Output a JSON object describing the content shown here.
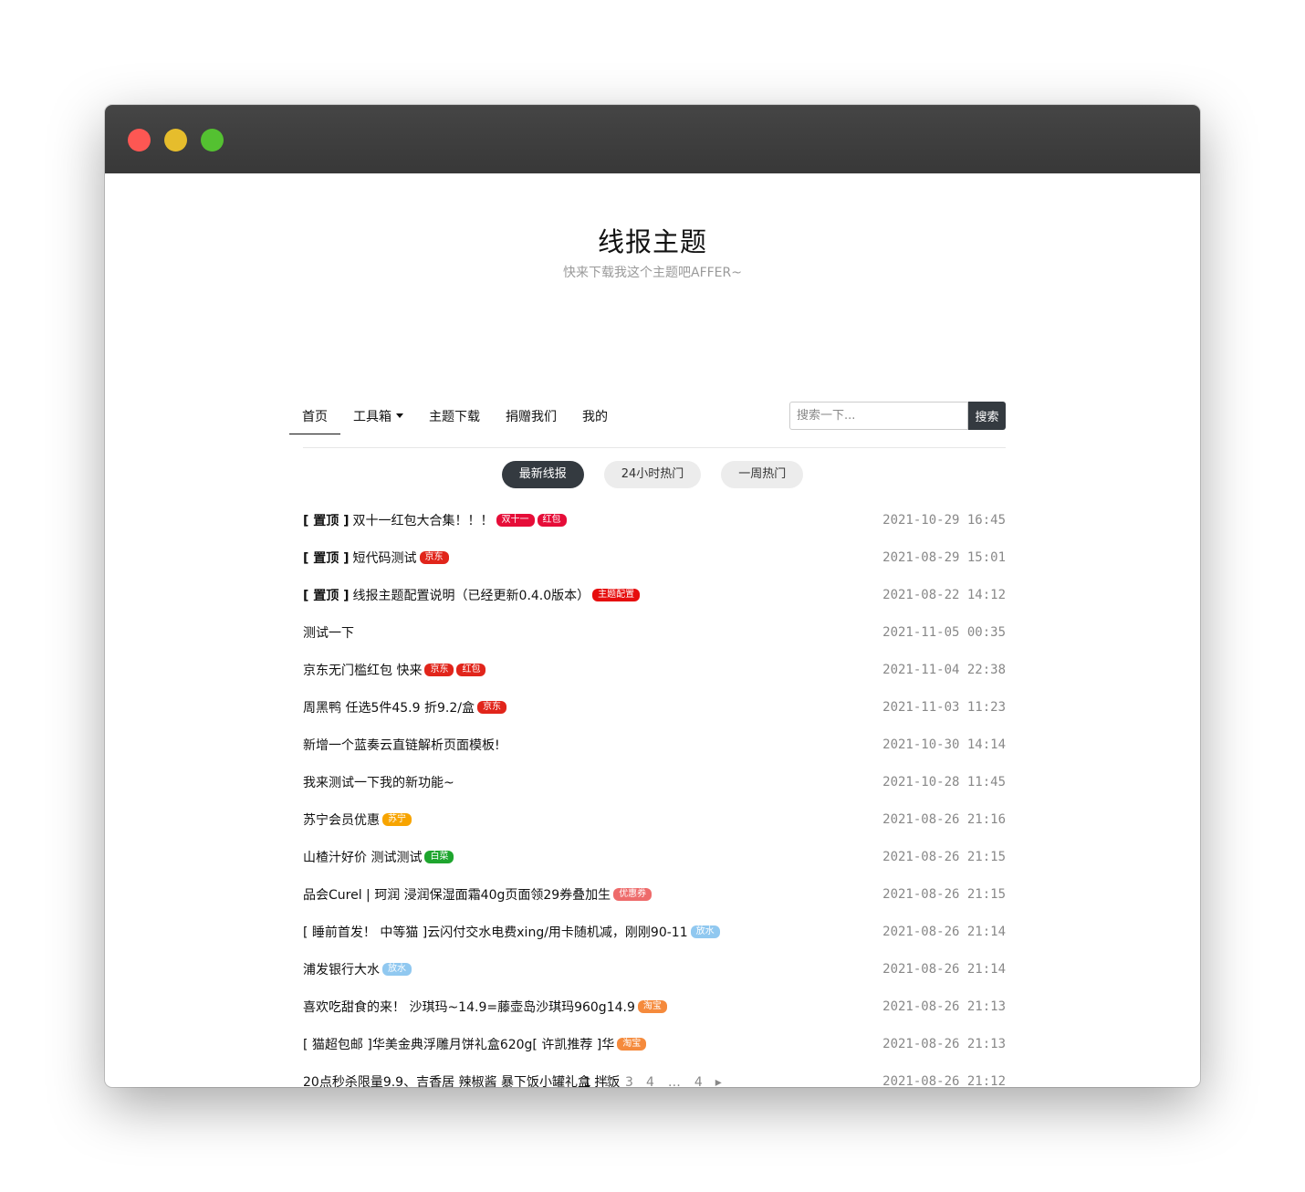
{
  "site": {
    "title": "线报主题",
    "subtitle": "快来下载我这个主题吧AFFER~"
  },
  "nav": {
    "items": [
      "首页",
      "工具箱",
      "主题下载",
      "捐赠我们",
      "我的"
    ]
  },
  "search": {
    "placeholder": "搜索一下...",
    "button": "搜索"
  },
  "tabs": [
    "最新线报",
    "24小时热门",
    "一周热门"
  ],
  "posts": [
    {
      "pinned": true,
      "pin_label": "[ 置顶 ]",
      "title": "双十一红包大合集！！！",
      "tags": [
        {
          "text": "双十一",
          "color": "#e60d38"
        },
        {
          "text": "红包",
          "color": "#e60d38"
        }
      ],
      "date": "2021-10-29 16:45"
    },
    {
      "pinned": true,
      "pin_label": "[ 置顶 ]",
      "title": "短代码测试",
      "tags": [
        {
          "text": "京东",
          "color": "#e1251b"
        }
      ],
      "date": "2021-08-29 15:01"
    },
    {
      "pinned": true,
      "pin_label": "[ 置顶 ]",
      "title": "线报主题配置说明（已经更新0.4.0版本）",
      "tags": [
        {
          "text": "主题配置",
          "color": "#e60d0d"
        }
      ],
      "date": "2021-08-22 14:12"
    },
    {
      "pinned": false,
      "pin_label": "",
      "title": "测试一下",
      "tags": [],
      "date": "2021-11-05 00:35"
    },
    {
      "pinned": false,
      "pin_label": "",
      "title": "京东无门槛红包 快来",
      "tags": [
        {
          "text": "京东",
          "color": "#e1251b"
        },
        {
          "text": "红包",
          "color": "#e1251b"
        }
      ],
      "date": "2021-11-04 22:38"
    },
    {
      "pinned": false,
      "pin_label": "",
      "title": "周黑鸭 任选5件45.9  折9.2/盒",
      "tags": [
        {
          "text": "京东",
          "color": "#e1251b"
        }
      ],
      "date": "2021-11-03 11:23"
    },
    {
      "pinned": false,
      "pin_label": "",
      "title": "新增一个蓝奏云直链解析页面模板!",
      "tags": [],
      "date": "2021-10-30 14:14"
    },
    {
      "pinned": false,
      "pin_label": "",
      "title": "我来测试一下我的新功能~",
      "tags": [],
      "date": "2021-10-28 11:45"
    },
    {
      "pinned": false,
      "pin_label": "",
      "title": "苏宁会员优惠",
      "tags": [
        {
          "text": "苏宁",
          "color": "#f7a400"
        }
      ],
      "date": "2021-08-26 21:16"
    },
    {
      "pinned": false,
      "pin_label": "",
      "title": "山楂汁好价 测试测试",
      "tags": [
        {
          "text": "白菜",
          "color": "#1ea52e"
        }
      ],
      "date": "2021-08-26 21:15"
    },
    {
      "pinned": false,
      "pin_label": "",
      "title": "品会Curel | 珂润 浸润保湿面霜40g页面领29券叠加生",
      "tags": [
        {
          "text": "优惠券",
          "color": "#ee6b6b"
        }
      ],
      "date": "2021-08-26 21:15"
    },
    {
      "pinned": false,
      "pin_label": "",
      "title": "[ 睡前首发！ 中等猫 ]云闪付交水电费xing/用卡随机减，刚刚90-11",
      "tags": [
        {
          "text": "放水",
          "color": "#90c8f0"
        }
      ],
      "date": "2021-08-26 21:14"
    },
    {
      "pinned": false,
      "pin_label": "",
      "title": "浦发银行大水",
      "tags": [
        {
          "text": "放水",
          "color": "#90c8f0"
        }
      ],
      "date": "2021-08-26 21:14"
    },
    {
      "pinned": false,
      "pin_label": "",
      "title": "喜欢吃甜食的来！ 沙琪玛~14.9=藤壶岛沙琪玛960g14.9",
      "tags": [
        {
          "text": "淘宝",
          "color": "#f58a3c"
        }
      ],
      "date": "2021-08-26 21:13"
    },
    {
      "pinned": false,
      "pin_label": "",
      "title": "[ 猫超包邮 ]华美金典浮雕月饼礼盒620g[ 许凯推荐 ]华",
      "tags": [
        {
          "text": "淘宝",
          "color": "#f58a3c"
        }
      ],
      "date": "2021-08-26 21:13"
    },
    {
      "pinned": false,
      "pin_label": "",
      "title": "20点秒杀限量9.9、吉香居 辣椒酱 暴下饭小罐礼盒 拌饭",
      "tags": [],
      "date": "2021-08-26 21:12"
    }
  ],
  "pagination": {
    "pages": [
      "1",
      "2",
      "3",
      "4"
    ],
    "ellipsis": "…",
    "last": "4",
    "next": "▸"
  }
}
